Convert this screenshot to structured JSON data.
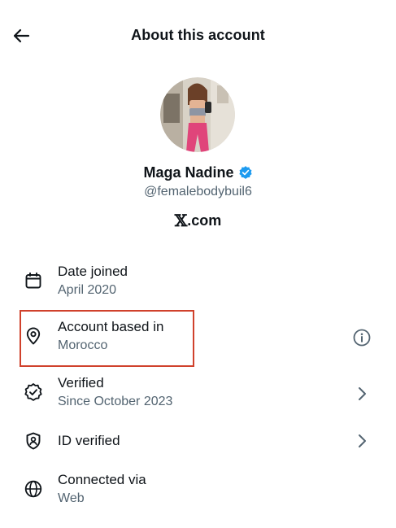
{
  "header": {
    "title": "About this account"
  },
  "profile": {
    "name": "Maga Nadine",
    "handle": "@femalebodybuil6",
    "site_symbol": "𝕏",
    "site_text": ".com"
  },
  "rows": [
    {
      "title": "Date joined",
      "subtitle": "April 2020",
      "icon": "calendar-icon"
    },
    {
      "title": "Account based in",
      "subtitle": "Morocco",
      "icon": "location-pin-icon",
      "trailing": "info-icon"
    },
    {
      "title": "Verified",
      "subtitle": "Since October 2023",
      "icon": "verified-badge-icon",
      "trailing": "chevron-right-icon"
    },
    {
      "title": "ID verified",
      "icon": "id-shield-icon",
      "trailing": "chevron-right-icon"
    },
    {
      "title": "Connected via",
      "subtitle": "Web",
      "icon": "globe-icon"
    }
  ],
  "colors": {
    "text": "#0f1419",
    "secondary": "#536471",
    "verified_blue": "#1d9bf0",
    "highlight_red": "#d0412c"
  }
}
